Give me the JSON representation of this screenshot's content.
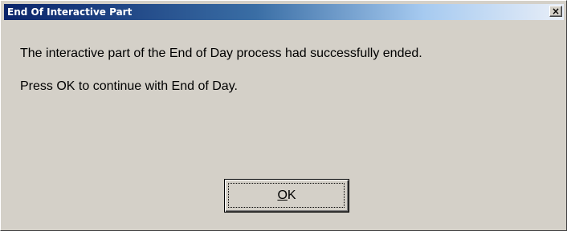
{
  "window": {
    "title": "End Of Interactive Part",
    "close_glyph": "×",
    "close_icon": "close-icon"
  },
  "message": {
    "line1": "The interactive part of the End of Day process had successfully ended.",
    "line2": "Press OK to continue with End of Day."
  },
  "button": {
    "ok_mnemonic": "O",
    "ok_rest": "K"
  },
  "colors": {
    "titlebar_start": "#0a246a",
    "titlebar_end": "#e8eef8",
    "dialog_face": "#d4d0c8"
  }
}
